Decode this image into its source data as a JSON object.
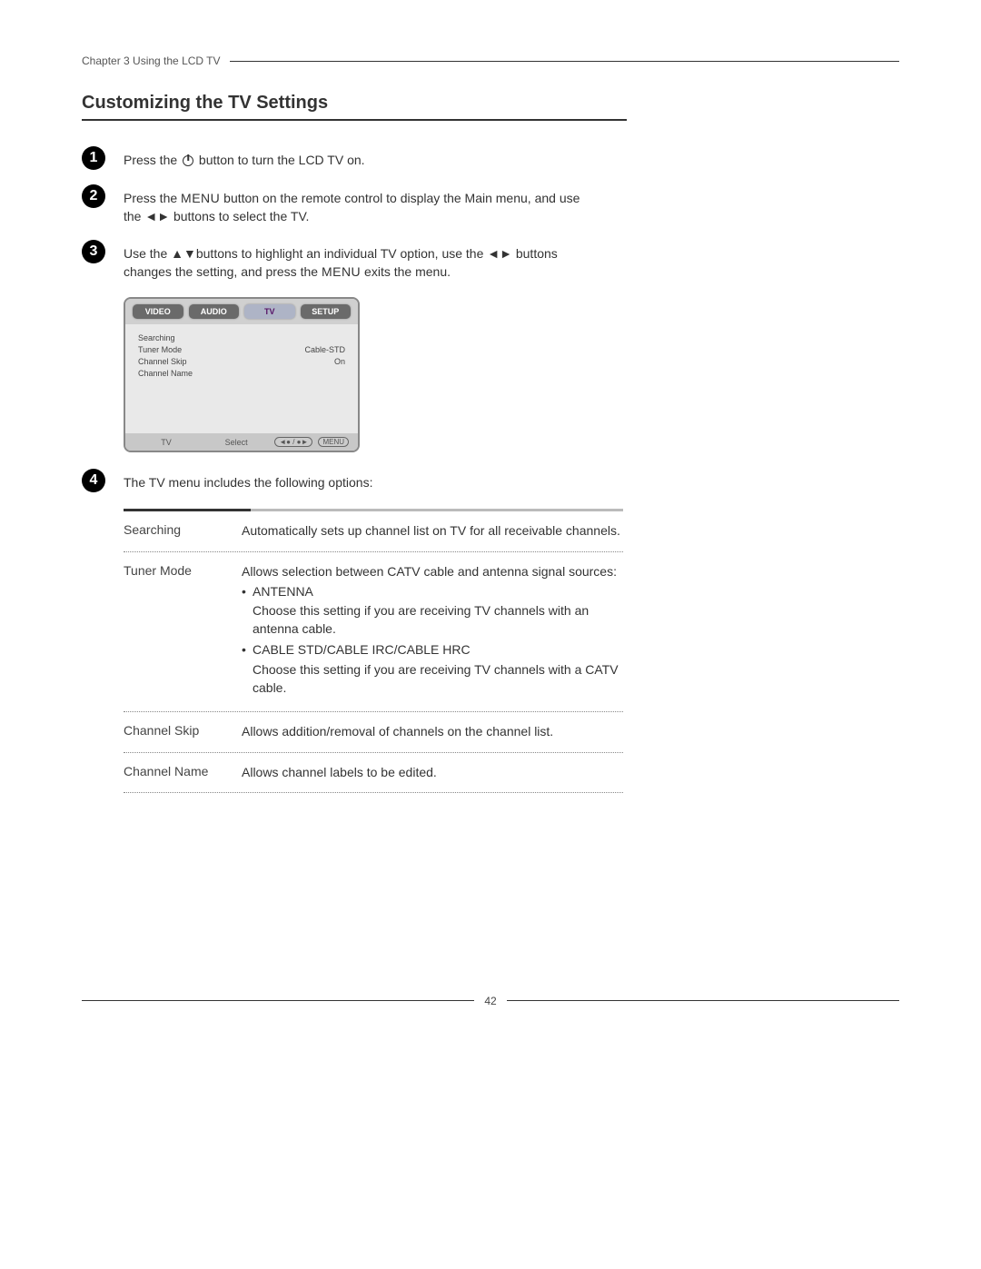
{
  "chapter_label": "Chapter 3 Using the LCD TV",
  "section_title": "Customizing the TV Settings",
  "steps": [
    {
      "num": "1",
      "parts": [
        {
          "t": "text",
          "v": "Press the "
        },
        {
          "t": "icon",
          "name": "power-icon"
        },
        {
          "t": "text",
          "v": " button to turn the LCD TV on."
        }
      ]
    },
    {
      "num": "2",
      "parts": [
        {
          "t": "text",
          "v": "Press the "
        },
        {
          "t": "menu",
          "v": "MENU"
        },
        {
          "t": "text",
          "v": " button on the remote control to display the Main menu, and use the ◄► buttons to select the TV."
        }
      ]
    },
    {
      "num": "3",
      "parts": [
        {
          "t": "text",
          "v": "Use the ▲▼buttons to highlight an individual TV option, use the ◄► buttons changes the setting, and press the "
        },
        {
          "t": "menu",
          "v": "MENU"
        },
        {
          "t": "text",
          "v": " exits the menu."
        }
      ]
    },
    {
      "num": "4",
      "parts": [
        {
          "t": "text",
          "v": "The TV menu includes the following options:"
        }
      ]
    }
  ],
  "osd": {
    "tabs": [
      "VIDEO",
      "AUDIO",
      "TV",
      "SETUP"
    ],
    "active_tab_index": 2,
    "rows": [
      {
        "label": "Searching",
        "value": ""
      },
      {
        "label": "Tuner Mode",
        "value": "Cable-STD"
      },
      {
        "label": "Channel Skip",
        "value": "On"
      },
      {
        "label": "Channel Name",
        "value": ""
      }
    ],
    "footer": {
      "left": "TV",
      "center": "Select",
      "arrows": "◄● / ●►",
      "menu": "MENU"
    }
  },
  "options": [
    {
      "name": "Searching",
      "desc": [
        {
          "t": "plain",
          "v": "Automatically sets up channel list on TV for all receivable channels."
        }
      ]
    },
    {
      "name": "Tuner Mode",
      "desc": [
        {
          "t": "plain",
          "v": "Allows selection between CATV cable and antenna signal sources:"
        },
        {
          "t": "bullet",
          "v": "ANTENNA"
        },
        {
          "t": "indent",
          "v": "Choose this setting if you are receiving TV channels with an antenna cable."
        },
        {
          "t": "bullet",
          "v": "CABLE STD/CABLE IRC/CABLE HRC"
        },
        {
          "t": "indent",
          "v": "Choose this setting if you are receiving TV channels with a CATV cable."
        }
      ]
    },
    {
      "name": "Channel Skip",
      "desc": [
        {
          "t": "plain",
          "v": "Allows addition/removal of channels on the channel list."
        }
      ]
    },
    {
      "name": "Channel Name",
      "desc": [
        {
          "t": "plain",
          "v": "Allows channel labels to be edited."
        }
      ]
    }
  ],
  "page_number": "42"
}
